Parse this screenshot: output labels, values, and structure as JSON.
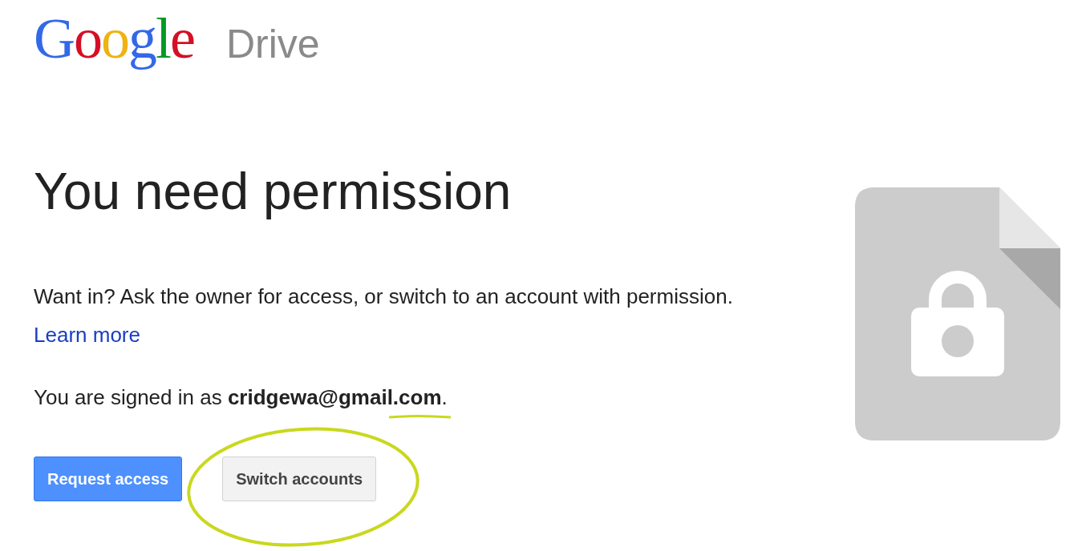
{
  "header": {
    "logo": "Google",
    "product": "Drive"
  },
  "title": "You need permission",
  "message": {
    "text": "Want in? Ask the owner for access, or switch to an account with permission.",
    "link": "Learn more"
  },
  "signed_in": "You are signed in as **cridgewa@gmail.com**.",
  "buttons": [
    {
      "label": "Request access",
      "kind": "primary"
    },
    {
      "label": "Switch accounts",
      "kind": "secondary"
    }
  ]
}
